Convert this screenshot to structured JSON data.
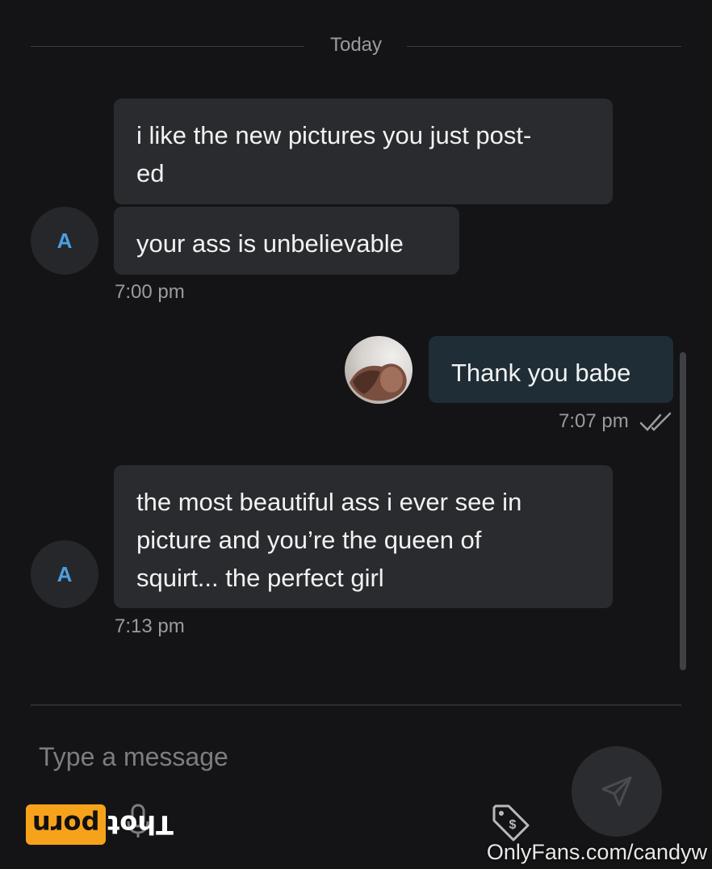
{
  "header": {
    "date_label": "Today"
  },
  "messages": [
    {
      "sender": "other",
      "avatar_initial": "A",
      "bubbles": [
        "i like the new pictures you just post-\ned",
        "your ass is unbelievable"
      ],
      "time": "7:00 pm"
    },
    {
      "sender": "me",
      "bubbles": [
        "Thank you babe"
      ],
      "time": "7:07 pm",
      "status": "read"
    },
    {
      "sender": "other",
      "avatar_initial": "A",
      "bubbles": [
        "the most beautiful ass i ever see in\npicture and you’re the queen of\nsquirt... the perfect girl"
      ],
      "time": "7:13 pm"
    }
  ],
  "composer": {
    "placeholder": "Type a message",
    "icons": [
      "microphone-icon",
      "price-tag-icon",
      "send-icon"
    ]
  },
  "overlays": {
    "logo_box_text": "Thot",
    "logo_rest_text": "porn",
    "watermark": "OnlyFans.com/candyw"
  },
  "colors": {
    "background": "#141416",
    "bubble_other": "#2a2b2f",
    "bubble_me": "#1f2d36",
    "avatar_text": "#4aa0e0",
    "logo_orange": "#f7a21b"
  }
}
